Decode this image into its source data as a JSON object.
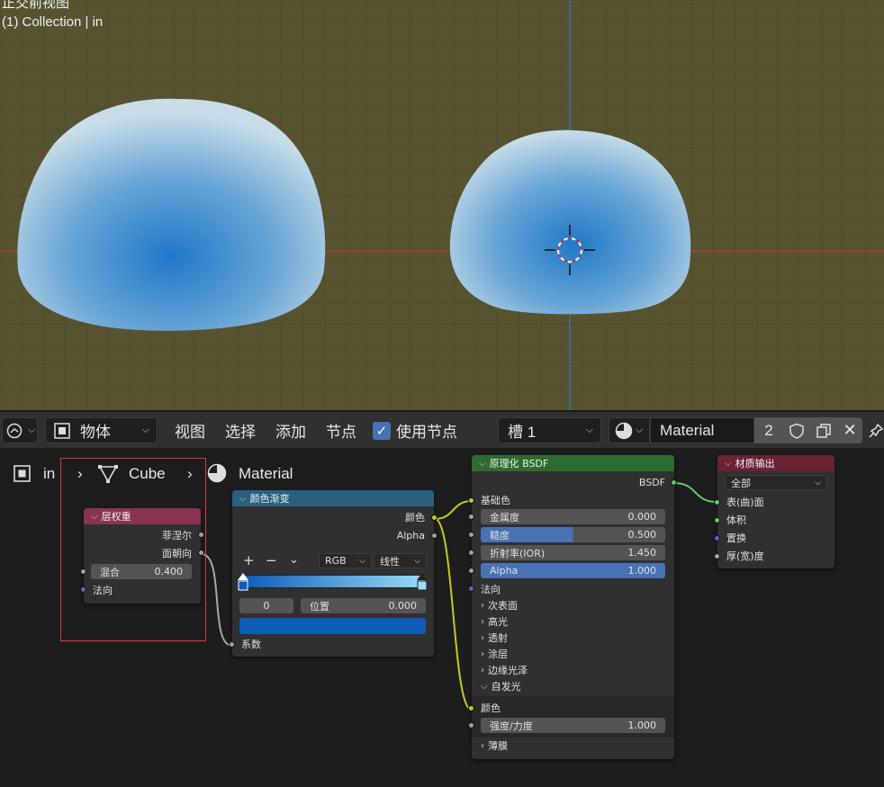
{
  "viewport": {
    "title": "正交前视图",
    "collection": "(1) Collection | in"
  },
  "header": {
    "editor_type_icon": "node-editor-icon",
    "mode": "物体",
    "menus": [
      "视图",
      "选择",
      "添加",
      "节点"
    ],
    "use_nodes_label": "使用节点",
    "use_nodes_checked": true,
    "slot": "槽 1",
    "material_name": "Material",
    "user_count": "2",
    "colors": {
      "bg": "#303030",
      "accent": "#4772b3"
    }
  },
  "breadcrumb": {
    "object": "in",
    "mesh": "Cube",
    "material": "Material"
  },
  "nodes": {
    "layer_weight": {
      "title": "层权重",
      "header_color": "#8a3350",
      "out_fresnel": "菲涅尔",
      "out_facing": "面朝向",
      "blend_label": "混合",
      "blend_value": "0.400",
      "normal_label": "法向"
    },
    "color_ramp": {
      "title": "颜色渐变",
      "header_color": "#2a5f80",
      "out_color": "颜色",
      "out_alpha": "Alpha",
      "add_btn": "+",
      "remove_btn": "−",
      "menu_btn": "⌄",
      "color_mode": "RGB",
      "interpolation": "线性",
      "stop_index": "0",
      "position_label": "位置",
      "position_value": "0.000",
      "stop_color": "#0f5bb8",
      "in_fac": "系数"
    },
    "principled": {
      "title": "原理化 BSDF",
      "header_color": "#2e6b2e",
      "out_bsdf": "BSDF",
      "base_color": "基础色",
      "metallic_label": "金属度",
      "metallic_value": "0.000",
      "roughness_label": "糙度",
      "roughness_value": "0.500",
      "ior_label": "折射率(IOR)",
      "ior_value": "1.450",
      "alpha_label": "Alpha",
      "alpha_value": "1.000",
      "normal": "法向",
      "panels": [
        "次表面",
        "高光",
        "透射",
        "涂层",
        "边缘光泽"
      ],
      "emission_panel": "自发光",
      "emission_color": "颜色",
      "strength_label": "强度/力度",
      "strength_value": "1.000",
      "thin_film": "薄膜"
    },
    "material_output": {
      "title": "材质输出",
      "header_color": "#6b2233",
      "target": "全部",
      "surface": "表(曲)面",
      "volume": "体积",
      "displacement": "置换",
      "thickness": "厚(宽)度"
    }
  }
}
